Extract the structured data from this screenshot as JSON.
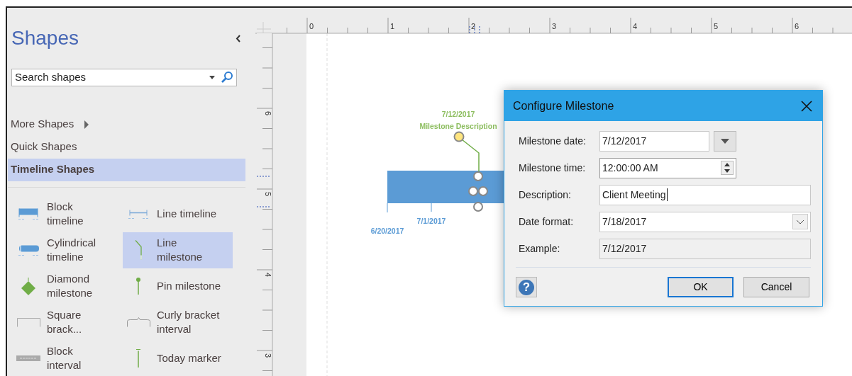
{
  "sidebar": {
    "title": "Shapes",
    "search": {
      "placeholder": "Search shapes"
    },
    "nav": [
      {
        "label": "More Shapes",
        "kind": "submenu",
        "selected": false
      },
      {
        "label": "Quick Shapes",
        "kind": "plain",
        "selected": false
      },
      {
        "label": "Timeline Shapes",
        "kind": "plain",
        "selected": true
      }
    ],
    "stencils": [
      {
        "label": "Block timeline",
        "kind": "block-timeline",
        "selected": false
      },
      {
        "label": "Line timeline",
        "kind": "line-timeline",
        "selected": false
      },
      {
        "label": "Cylindrical timeline",
        "kind": "cylinder-timeline",
        "selected": false
      },
      {
        "label": "Line milestone",
        "kind": "line-milestone",
        "selected": true
      },
      {
        "label": "Diamond milestone",
        "kind": "diamond-milestone",
        "selected": false
      },
      {
        "label": "Pin milestone",
        "kind": "pin-milestone",
        "selected": false
      },
      {
        "label": "Square brack...",
        "kind": "square-bracket",
        "selected": false
      },
      {
        "label": "Curly bracket interval",
        "kind": "curly-bracket",
        "selected": false
      },
      {
        "label": "Block interval",
        "kind": "block-interval",
        "selected": false
      },
      {
        "label": "Today marker",
        "kind": "today-marker",
        "selected": false
      }
    ]
  },
  "ruler": {
    "horizontal": [
      "0",
      "1",
      "2",
      "3",
      "4",
      "5",
      "6"
    ],
    "vertical": [
      "6",
      "5",
      "4",
      "3"
    ]
  },
  "timeline": {
    "milestone_date": "7/12/2017",
    "milestone_description": "Milestone Description",
    "dates": [
      "6/20/2017",
      "7/1/2017"
    ]
  },
  "dialog": {
    "title": "Configure Milestone",
    "fields": [
      {
        "label": "Milestone date:",
        "kind": "date",
        "value": "7/12/2017"
      },
      {
        "label": "Milestone time:",
        "kind": "time",
        "value": "12:00:00 AM"
      },
      {
        "label": "Description:",
        "kind": "text",
        "value": "Client Meeting",
        "focused": true
      },
      {
        "label": "Date format:",
        "kind": "select",
        "value": "7/18/2017"
      },
      {
        "label": "Example:",
        "kind": "readonly",
        "value": "7/12/2017"
      }
    ],
    "help": "?",
    "buttons": [
      {
        "label": "OK",
        "default": true
      },
      {
        "label": "Cancel",
        "default": false
      }
    ]
  }
}
